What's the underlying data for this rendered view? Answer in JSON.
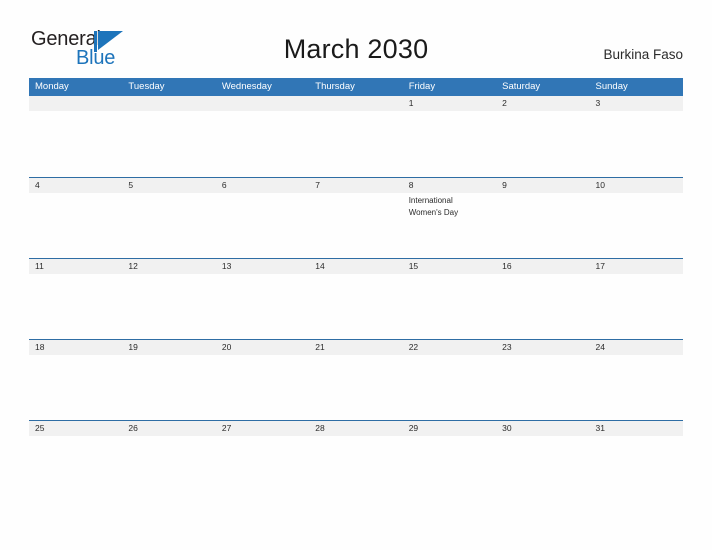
{
  "brand": {
    "name_part1": "General",
    "name_part2": "Blue",
    "flag_icon": "blue-triangle-flag-icon",
    "accent_color": "#1d74bb"
  },
  "header": {
    "title": "March 2030",
    "country": "Burkina Faso"
  },
  "colors": {
    "weekday_header_bg": "#3176b6",
    "week_border": "#2e6da4",
    "date_band_bg": "#f1f1f1",
    "page_bg": "#fefefe",
    "text": "#2b2b2b"
  },
  "calendar": {
    "weekdays": [
      "Monday",
      "Tuesday",
      "Wednesday",
      "Thursday",
      "Friday",
      "Saturday",
      "Sunday"
    ],
    "weeks": [
      {
        "days": [
          {
            "num": "",
            "events": []
          },
          {
            "num": "",
            "events": []
          },
          {
            "num": "",
            "events": []
          },
          {
            "num": "",
            "events": []
          },
          {
            "num": "1",
            "events": []
          },
          {
            "num": "2",
            "events": []
          },
          {
            "num": "3",
            "events": []
          }
        ]
      },
      {
        "days": [
          {
            "num": "4",
            "events": []
          },
          {
            "num": "5",
            "events": []
          },
          {
            "num": "6",
            "events": []
          },
          {
            "num": "7",
            "events": []
          },
          {
            "num": "8",
            "events": [
              "International",
              "Women's Day"
            ]
          },
          {
            "num": "9",
            "events": []
          },
          {
            "num": "10",
            "events": []
          }
        ]
      },
      {
        "days": [
          {
            "num": "11",
            "events": []
          },
          {
            "num": "12",
            "events": []
          },
          {
            "num": "13",
            "events": []
          },
          {
            "num": "14",
            "events": []
          },
          {
            "num": "15",
            "events": []
          },
          {
            "num": "16",
            "events": []
          },
          {
            "num": "17",
            "events": []
          }
        ]
      },
      {
        "days": [
          {
            "num": "18",
            "events": []
          },
          {
            "num": "19",
            "events": []
          },
          {
            "num": "20",
            "events": []
          },
          {
            "num": "21",
            "events": []
          },
          {
            "num": "22",
            "events": []
          },
          {
            "num": "23",
            "events": []
          },
          {
            "num": "24",
            "events": []
          }
        ]
      },
      {
        "days": [
          {
            "num": "25",
            "events": []
          },
          {
            "num": "26",
            "events": []
          },
          {
            "num": "27",
            "events": []
          },
          {
            "num": "28",
            "events": []
          },
          {
            "num": "29",
            "events": []
          },
          {
            "num": "30",
            "events": []
          },
          {
            "num": "31",
            "events": []
          }
        ]
      }
    ]
  }
}
